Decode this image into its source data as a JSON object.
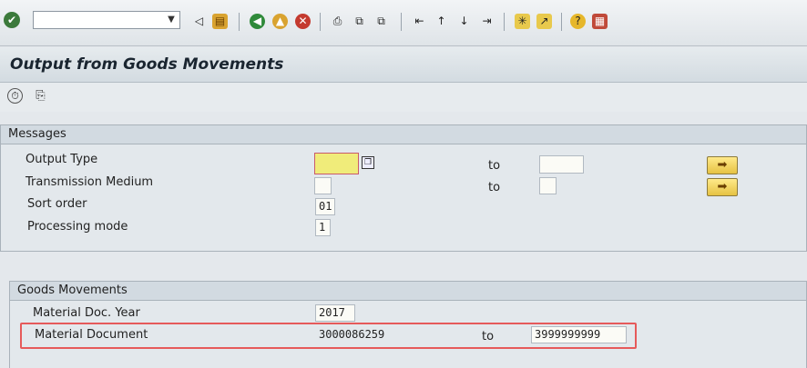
{
  "toolbar": {
    "command_field_value": "",
    "icons": [
      "enter-icon",
      "back-icon",
      "save-icon",
      "back-nav-icon",
      "exit-icon",
      "cancel-icon",
      "print-icon",
      "find-icon",
      "find-next-icon",
      "first-page-icon",
      "previous-page-icon",
      "next-page-icon",
      "last-page-icon",
      "create-session-icon",
      "shortcut-icon",
      "help-icon",
      "customize-layout-icon"
    ]
  },
  "page": {
    "title": "Output from Goods Movements"
  },
  "app_toolbar": {
    "icons": [
      "execute-icon",
      "get-variant-icon"
    ]
  },
  "messages": {
    "heading": "Messages",
    "output_type_label": "Output Type",
    "output_type_value": "",
    "output_type_to_label": "to",
    "output_type_to_value": "",
    "transmission_medium_label": "Transmission Medium",
    "transmission_medium_value": "",
    "transmission_medium_to_label": "to",
    "transmission_medium_to_value": "",
    "sort_order_label": "Sort order",
    "sort_order_value": "01",
    "processing_mode_label": "Processing mode",
    "processing_mode_value": "1"
  },
  "goods_movements": {
    "heading": "Goods Movements",
    "doc_year_label": "Material Doc. Year",
    "doc_year_value": "2017",
    "material_document_label": "Material Document",
    "material_document_from": "3000086259",
    "material_document_to_label": "to",
    "material_document_to": "3999999999"
  },
  "colors": {
    "highlight": "#e65a5a",
    "required_field": "#f0ec7a",
    "multiple_selection": "#e6c243"
  }
}
